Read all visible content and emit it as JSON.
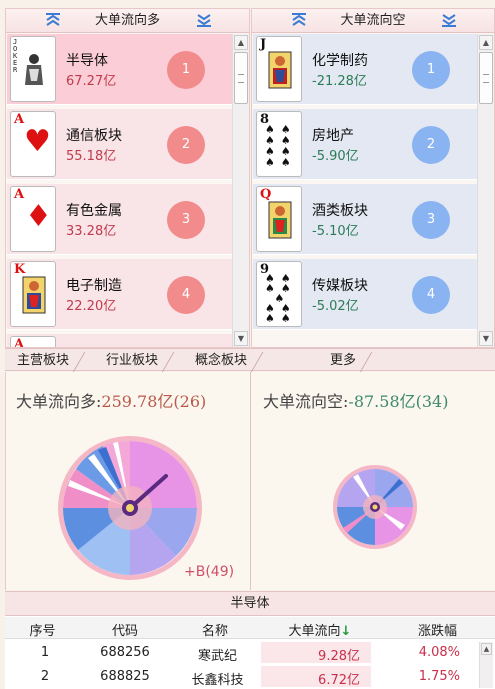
{
  "left_panel": {
    "title": "大单流向多",
    "rows": [
      {
        "card_rank": "JOKER",
        "card_suit": "joker",
        "suit_color": "black",
        "name": "半导体",
        "value": "67.27亿",
        "rank": "1"
      },
      {
        "card_rank": "A",
        "card_suit": "♥",
        "suit_color": "red",
        "name": "通信板块",
        "value": "55.18亿",
        "rank": "2"
      },
      {
        "card_rank": "A",
        "card_suit": "♦",
        "suit_color": "red",
        "name": "有色金属",
        "value": "33.28亿",
        "rank": "3"
      },
      {
        "card_rank": "K",
        "card_suit": "♥",
        "suit_color": "red",
        "name": "电子制造",
        "value": "22.20亿",
        "rank": "4"
      },
      {
        "card_rank": "A",
        "card_suit": "",
        "suit_color": "red",
        "name": "",
        "value": "",
        "rank": ""
      }
    ]
  },
  "right_panel": {
    "title": "大单流向空",
    "rows": [
      {
        "card_rank": "J",
        "card_suit": "♣",
        "suit_color": "black",
        "name": "化学制药",
        "value": "-21.28亿",
        "rank": "1"
      },
      {
        "card_rank": "8",
        "card_suit": "♠",
        "suit_color": "black",
        "name": "房地产",
        "value": "-5.90亿",
        "rank": "2"
      },
      {
        "card_rank": "Q",
        "card_suit": "♦",
        "suit_color": "red",
        "name": "酒类板块",
        "value": "-5.10亿",
        "rank": "3"
      },
      {
        "card_rank": "9",
        "card_suit": "♠",
        "suit_color": "black",
        "name": "传媒板块",
        "value": "-5.02亿",
        "rank": "4"
      }
    ]
  },
  "tabs": [
    "主营板块",
    "行业板块",
    "概念板块",
    "更多"
  ],
  "flow_positive": {
    "label": "大单流向多:",
    "value": "259.78亿",
    "count": "(26)",
    "note": "+B(49)"
  },
  "flow_negative": {
    "label": "大单流向空:",
    "value": "-87.58亿",
    "count": "(34)"
  },
  "table": {
    "caption": "半导体",
    "headers": [
      "序号",
      "代码",
      "名称",
      "大单流向",
      "涨跌幅"
    ],
    "sort_indicator": "↓",
    "rows": [
      {
        "idx": "1",
        "code": "688256",
        "name": "寒武纪",
        "flow": "9.28亿",
        "change": "4.08%"
      },
      {
        "idx": "2",
        "code": "688825",
        "name": "长鑫科技",
        "flow": "6.72亿",
        "change": "1.75%"
      }
    ]
  },
  "colors": {
    "positive": "#c13a4c",
    "negative": "#2a7c55",
    "rank_pos": "#f28b8b",
    "rank_neg": "#8ab3f2"
  }
}
